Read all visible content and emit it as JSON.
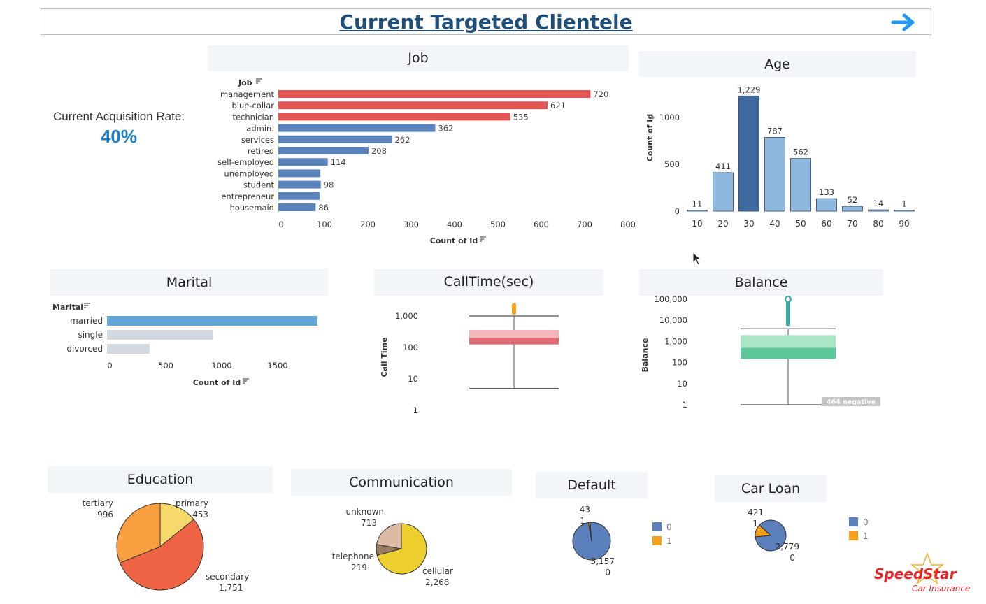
{
  "header": {
    "title": "Current Targeted Clientele"
  },
  "acquisition": {
    "label": "Current Acquisition Rate:",
    "value": "40%"
  },
  "panels": {
    "job": "Job",
    "age": "Age",
    "marital": "Marital",
    "calltime": "CallTime(sec)",
    "balance": "Balance",
    "education": "Education",
    "communication": "Communication",
    "default": "Default",
    "car_loan": "Car Loan"
  },
  "logo": {
    "brand": "SpeedStar",
    "sub": "Car Insurance"
  },
  "colors": {
    "red": "#e45756",
    "blue": "#5b84bd",
    "dark_blue": "#3f6aa0",
    "light_blue": "#8fb8df",
    "orange": "#f59a23",
    "accent": "#1f4e79"
  },
  "chart_data": [
    {
      "id": "job",
      "type": "bar",
      "orientation": "horizontal",
      "dim_label": "Job",
      "xlabel": "Count of Id",
      "categories": [
        "management",
        "blue-collar",
        "technician",
        "admin.",
        "services",
        "retired",
        "self-employed",
        "unemployed",
        "student",
        "entrepreneur",
        "housemaid"
      ],
      "values": [
        720,
        621,
        535,
        362,
        262,
        208,
        114,
        97,
        98,
        95,
        86
      ],
      "labels": [
        "720",
        "621",
        "535",
        "362",
        "262",
        "208",
        "114",
        "",
        "98",
        "",
        "86"
      ],
      "highlight": [
        true,
        true,
        true,
        false,
        false,
        false,
        false,
        false,
        false,
        false,
        false
      ],
      "xlim": [
        0,
        800
      ],
      "xticks": [
        "0",
        "100",
        "200",
        "300",
        "400",
        "500",
        "600",
        "700",
        "800"
      ]
    },
    {
      "id": "age",
      "type": "bar",
      "ylabel": "Count of Id",
      "categories": [
        "10",
        "20",
        "30",
        "40",
        "50",
        "60",
        "70",
        "80",
        "90"
      ],
      "values": [
        11,
        411,
        1229,
        787,
        562,
        133,
        52,
        14,
        1
      ],
      "labels": [
        "11",
        "411",
        "1,229",
        "787",
        "562",
        "133",
        "52",
        "14",
        "1"
      ],
      "highlight": [
        false,
        false,
        true,
        false,
        false,
        false,
        false,
        false,
        false
      ],
      "ylim": [
        0,
        1300
      ],
      "yticks": [
        {
          "v": 0,
          "t": "0"
        },
        {
          "v": 500,
          "t": "500"
        },
        {
          "v": 1000,
          "t": "1000"
        }
      ]
    },
    {
      "id": "marital",
      "type": "bar",
      "orientation": "horizontal",
      "dim_label": "Marital",
      "xlabel": "Count of Id",
      "categories": [
        "married",
        "single",
        "divorced"
      ],
      "values": [
        1880,
        950,
        380
      ],
      "highlight": [
        true,
        false,
        false
      ],
      "xlim": [
        0,
        1950
      ],
      "xticks": [
        {
          "v": 0,
          "t": "0"
        },
        {
          "v": 500,
          "t": "500"
        },
        {
          "v": 1000,
          "t": "1000"
        },
        {
          "v": 1500,
          "t": "1500"
        }
      ]
    },
    {
      "id": "calltime",
      "type": "box",
      "scale": "log",
      "ylabel": "Call Time",
      "yticks": [
        {
          "v": 1,
          "t": "1"
        },
        {
          "v": 10,
          "t": "10"
        },
        {
          "v": 100,
          "t": "100"
        },
        {
          "v": 1000,
          "t": "1,000"
        }
      ],
      "whisker_low": 5,
      "q1": 125,
      "median": 200,
      "q3": 360,
      "whisker_high": 1000,
      "outlier_top": 2600,
      "outlier_bottom": 1100
    },
    {
      "id": "balance",
      "type": "box",
      "scale": "log",
      "ylabel": "Balance",
      "yticks": [
        {
          "v": 1,
          "t": "1"
        },
        {
          "v": 10,
          "t": "10"
        },
        {
          "v": 100,
          "t": "100"
        },
        {
          "v": 1000,
          "t": "1,000"
        },
        {
          "v": 10000,
          "t": "10,000"
        },
        {
          "v": 100000,
          "t": "100,000"
        }
      ],
      "whisker_low": 1,
      "q1": 150,
      "median": 500,
      "q3": 2000,
      "whisker_high": 4000,
      "outlier_top": 100000,
      "outlier_bottom": 5000,
      "note": "464 negative"
    },
    {
      "id": "education",
      "type": "pie",
      "slices": [
        {
          "name": "primary",
          "value": 453,
          "label": "453",
          "color": "#f6d86b"
        },
        {
          "name": "secondary",
          "value": 1751,
          "label": "1,751",
          "color": "#ef6445"
        },
        {
          "name": "tertiary",
          "value": 996,
          "label": "996",
          "color": "#fba040"
        }
      ]
    },
    {
      "id": "communication",
      "type": "pie",
      "slices": [
        {
          "name": "cellular",
          "value": 2268,
          "label": "2,268",
          "color": "#eccf2f"
        },
        {
          "name": "telephone",
          "value": 219,
          "label": "219",
          "color": "#9b7a62"
        },
        {
          "name": "unknown",
          "value": 713,
          "label": "713",
          "color": "#dcbba5"
        }
      ]
    },
    {
      "id": "default",
      "type": "pie",
      "slices": [
        {
          "name": "0",
          "value": 3157,
          "label": "3,157",
          "sublabel": "0",
          "color": "#5b7fba"
        },
        {
          "name": "1",
          "value": 43,
          "label": "43",
          "sublabel": "1",
          "color": "#f5a01a"
        }
      ],
      "legend": [
        "0",
        "1"
      ]
    },
    {
      "id": "car_loan",
      "type": "pie",
      "slices": [
        {
          "name": "0",
          "value": 2779,
          "label": "2,779",
          "sublabel": "0",
          "color": "#5b7fba"
        },
        {
          "name": "1",
          "value": 421,
          "label": "421",
          "sublabel": "1",
          "color": "#f5a01a"
        }
      ],
      "legend": [
        "0",
        "1"
      ]
    }
  ]
}
